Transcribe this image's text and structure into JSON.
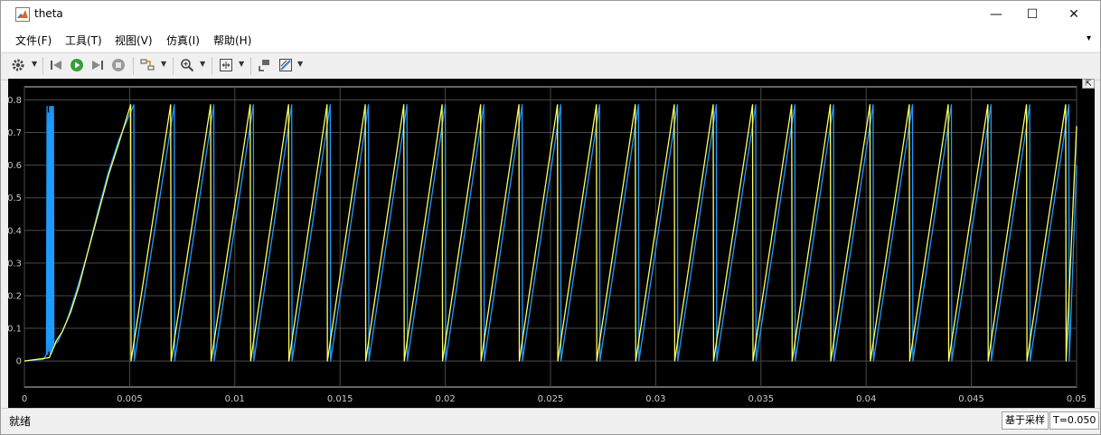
{
  "window": {
    "title": "theta",
    "minimize": "—",
    "maximize": "☐",
    "close": "✕"
  },
  "menu": [
    "文件(F)",
    "工具(T)",
    "视图(V)",
    "仿真(I)",
    "帮助(H)"
  ],
  "toolbar": {
    "icons": [
      "gear-icon",
      "step-back-icon",
      "run-icon",
      "step-forward-icon",
      "stop-icon",
      "highlight-icon",
      "zoom-icon",
      "fit-icon",
      "cursor-icon",
      "style-icon"
    ]
  },
  "status": {
    "left": "就绪",
    "mode": "基于采样",
    "time": "T=0.050"
  },
  "colors": {
    "background": "#000000",
    "grid": "#4a4a4a",
    "axis_text": "#c8c8c8",
    "series1": "#ffff66",
    "series2": "#1e9bff"
  },
  "chart_data": {
    "type": "line",
    "xlim": [
      0,
      0.05
    ],
    "ylim": [
      -0.08,
      0.84
    ],
    "xticks": [
      0,
      0.005,
      0.01,
      0.015,
      0.02,
      0.025,
      0.03,
      0.035,
      0.04,
      0.045,
      0.05
    ],
    "xtick_labels": [
      "0",
      "0.005",
      "0.01",
      "0.015",
      "0.02",
      "0.025",
      "0.03",
      "0.035",
      "0.04",
      "0.045",
      "0.05"
    ],
    "yticks": [
      0,
      0.1,
      0.2,
      0.3,
      0.4,
      0.5,
      0.6,
      0.7,
      0.8
    ],
    "ytick_labels": [
      "0",
      "0.1",
      "0.2",
      "0.3",
      "0.4",
      "0.5",
      "0.6",
      "0.7",
      "0.8"
    ],
    "grid": true,
    "series": [
      {
        "color": "#ffff66",
        "x": [
          0,
          0.00118,
          0.00125,
          0.00132,
          0.00138,
          0.00145,
          0.0015,
          0.0018,
          0.0022,
          0.0026,
          0.003,
          0.0035,
          0.004,
          0.0045,
          0.00505,
          0.00507,
          0.00695,
          0.00697,
          0.00885,
          0.00887,
          0.01073,
          0.01075,
          0.01255,
          0.01257,
          0.01438,
          0.0144,
          0.0162,
          0.01622,
          0.01803,
          0.01805,
          0.01985,
          0.01987,
          0.02168,
          0.0217,
          0.0235,
          0.02352,
          0.02533,
          0.02535,
          0.02718,
          0.0272,
          0.02903,
          0.02905,
          0.03088,
          0.0309,
          0.03273,
          0.03275,
          0.0346,
          0.03462,
          0.03646,
          0.03648,
          0.0383,
          0.03832,
          0.04018,
          0.0402,
          0.04205,
          0.04207,
          0.0439,
          0.04392,
          0.04578,
          0.0458,
          0.04762,
          0.04764,
          0.04948,
          0.0495,
          0.05
        ],
        "y": [
          0,
          0.01,
          0.02,
          0.03,
          0.04,
          0.05,
          0.06,
          0.09,
          0.15,
          0.23,
          0.33,
          0.45,
          0.57,
          0.67,
          0.785,
          0,
          0.785,
          0,
          0.785,
          0,
          0.785,
          0,
          0.785,
          0,
          0.785,
          0,
          0.785,
          0,
          0.785,
          0,
          0.785,
          0,
          0.785,
          0,
          0.785,
          0,
          0.785,
          0,
          0.785,
          0,
          0.785,
          0,
          0.785,
          0,
          0.785,
          0,
          0.785,
          0,
          0.785,
          0,
          0.785,
          0,
          0.785,
          0,
          0.785,
          0,
          0.785,
          0,
          0.785,
          0,
          0.785,
          0,
          0.785,
          0,
          0.72
        ]
      },
      {
        "color": "#1e9bff",
        "x": [
          0,
          0.0009,
          0.00105,
          0.00108,
          0.00111,
          0.00114,
          0.00117,
          0.0012,
          0.00123,
          0.00126,
          0.00129,
          0.00132,
          0.00135,
          0.00138,
          0.0014,
          0.0016,
          0.002,
          0.0025,
          0.003,
          0.0035,
          0.004,
          0.0045,
          0.0052,
          0.00522,
          0.00712,
          0.00714,
          0.009,
          0.00902,
          0.01088,
          0.0109,
          0.0127,
          0.01272,
          0.01453,
          0.01455,
          0.01635,
          0.01637,
          0.01818,
          0.0182,
          0.02,
          0.02002,
          0.02183,
          0.02185,
          0.02365,
          0.02367,
          0.02548,
          0.0255,
          0.02733,
          0.02735,
          0.02918,
          0.0292,
          0.03103,
          0.03105,
          0.03288,
          0.0329,
          0.03475,
          0.03477,
          0.03661,
          0.03663,
          0.03845,
          0.03847,
          0.04033,
          0.04035,
          0.0422,
          0.04222,
          0.04405,
          0.04407,
          0.04593,
          0.04595,
          0.04777,
          0.04779,
          0.04963,
          0.04965,
          0.05
        ],
        "y": [
          0,
          0.005,
          0.02,
          0.78,
          0.02,
          0.76,
          0.03,
          0.78,
          0.02,
          0.78,
          0.03,
          0.78,
          0.04,
          0.78,
          0.05,
          0.06,
          0.12,
          0.22,
          0.33,
          0.46,
          0.58,
          0.68,
          0.785,
          0,
          0.785,
          0,
          0.785,
          0,
          0.785,
          0,
          0.785,
          0,
          0.785,
          0,
          0.785,
          0,
          0.785,
          0,
          0.785,
          0,
          0.785,
          0,
          0.785,
          0,
          0.785,
          0,
          0.785,
          0,
          0.785,
          0,
          0.785,
          0,
          0.785,
          0,
          0.785,
          0,
          0.785,
          0,
          0.785,
          0,
          0.785,
          0,
          0.785,
          0,
          0.785,
          0,
          0.785,
          0,
          0.785,
          0,
          0.785,
          0,
          0.6
        ]
      }
    ]
  }
}
